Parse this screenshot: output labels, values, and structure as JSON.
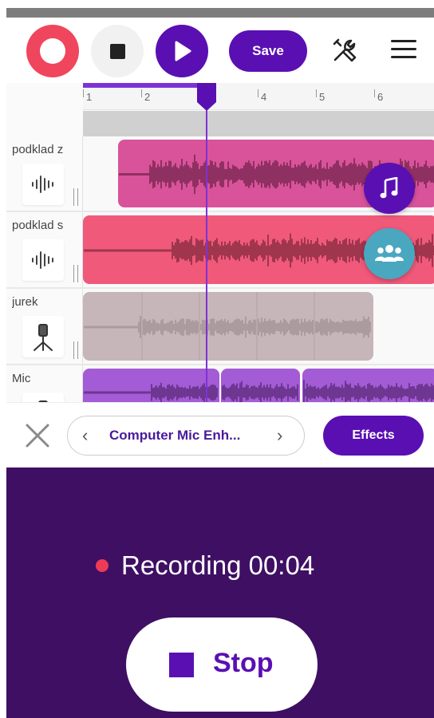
{
  "toolbar": {
    "save_label": "Save",
    "record_color": "#f0465d",
    "accent_color": "#5a0fb3"
  },
  "ruler": {
    "ticks": [
      "1",
      "2",
      "4",
      "5",
      "6"
    ],
    "playhead_position_label": "3"
  },
  "tracks": [
    {
      "name": "podklad z",
      "icon": "waveform-icon",
      "clip_color": "#d9539a"
    },
    {
      "name": "podklad s",
      "icon": "waveform-icon",
      "clip_color": "#f0597a"
    },
    {
      "name": "jurek",
      "icon": "microphone-stand-icon",
      "clip_color": "#c6b5b9"
    },
    {
      "name": "Mic",
      "icon": "microphone-stand-icon",
      "clip_color": "#a45bd6"
    }
  ],
  "floating": {
    "music_icon": "music-note-icon",
    "collab_icon": "people-group-icon"
  },
  "effects_bar": {
    "effect_name": "Computer Mic Enh...",
    "effects_label": "Effects",
    "prev": "‹",
    "next": "›"
  },
  "recording": {
    "status_text": "Recording 00:04",
    "stop_label": "Stop"
  }
}
